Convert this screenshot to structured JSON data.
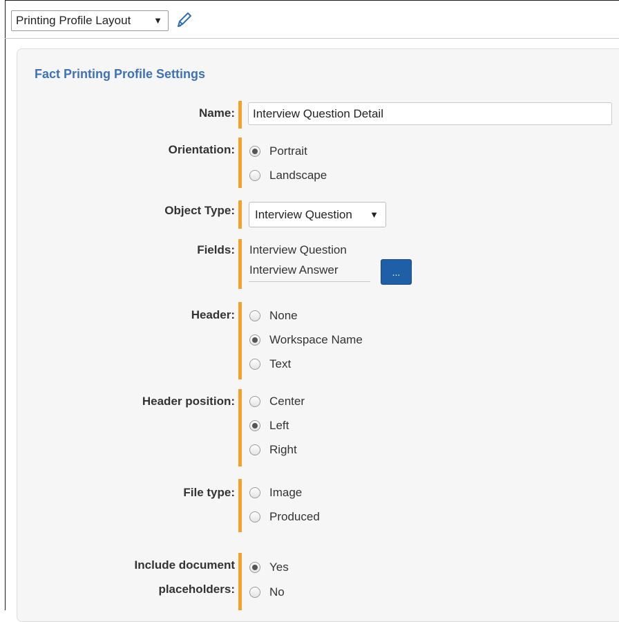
{
  "toolbar": {
    "layout_select_value": "Printing Profile Layout",
    "caret": "▼",
    "edit_icon": "pencil-icon"
  },
  "section_title": "Fact Printing Profile Settings",
  "form": {
    "name": {
      "label": "Name:",
      "value": "Interview Question Detail"
    },
    "orientation": {
      "label": "Orientation:",
      "options": [
        "Portrait",
        "Landscape"
      ],
      "selected": "Portrait"
    },
    "object_type": {
      "label": "Object Type:",
      "value": "Interview Question",
      "caret": "▼"
    },
    "fields": {
      "label": "Fields:",
      "items": [
        "Interview Question",
        "Interview Answer"
      ],
      "button_label": "..."
    },
    "header": {
      "label": "Header:",
      "options": [
        "None",
        "Workspace Name",
        "Text"
      ],
      "selected": "Workspace Name"
    },
    "header_position": {
      "label": "Header position:",
      "options": [
        "Center",
        "Left",
        "Right"
      ],
      "selected": "Left"
    },
    "file_type": {
      "label": "File type:",
      "options": [
        "Image",
        "Produced"
      ],
      "selected": null
    },
    "include_placeholders": {
      "label_line1": "Include document",
      "label_line2": "placeholders:",
      "options": [
        "Yes",
        "No"
      ],
      "selected": "Yes"
    }
  },
  "colors": {
    "accent_bar": "#f2a12b",
    "title_blue": "#3d72b8",
    "button_blue": "#1f5fa8"
  }
}
